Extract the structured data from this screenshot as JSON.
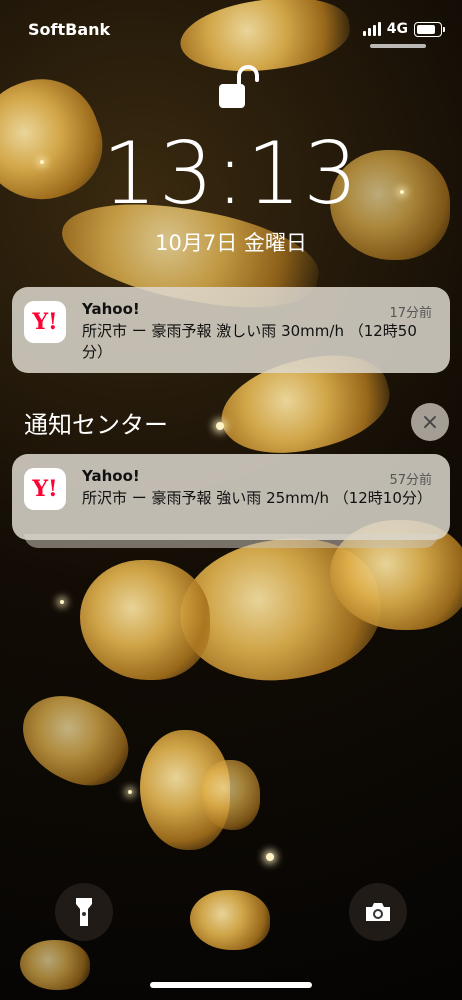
{
  "status": {
    "carrier": "SoftBank",
    "network": "4G",
    "battery_percent": 70
  },
  "lock_icon": "unlocked-padlock-icon",
  "clock": {
    "time": "13:13",
    "date": "10月7日 金曜日"
  },
  "notifications": [
    {
      "app": "Yahoo!",
      "app_icon_text": "Y!",
      "timestamp": "17分前",
      "message": "所沢市 ー 豪雨予報 激しい雨 30mm/h （12時50分）"
    }
  ],
  "notification_center": {
    "title": "通知センター",
    "close_symbol": "×",
    "items": [
      {
        "app": "Yahoo!",
        "app_icon_text": "Y!",
        "timestamp": "57分前",
        "message": "所沢市 ー 豪雨予報 強い雨 25mm/h （12時10分）"
      }
    ]
  },
  "bottom": {
    "left": "flashlight-icon",
    "right": "camera-icon"
  }
}
